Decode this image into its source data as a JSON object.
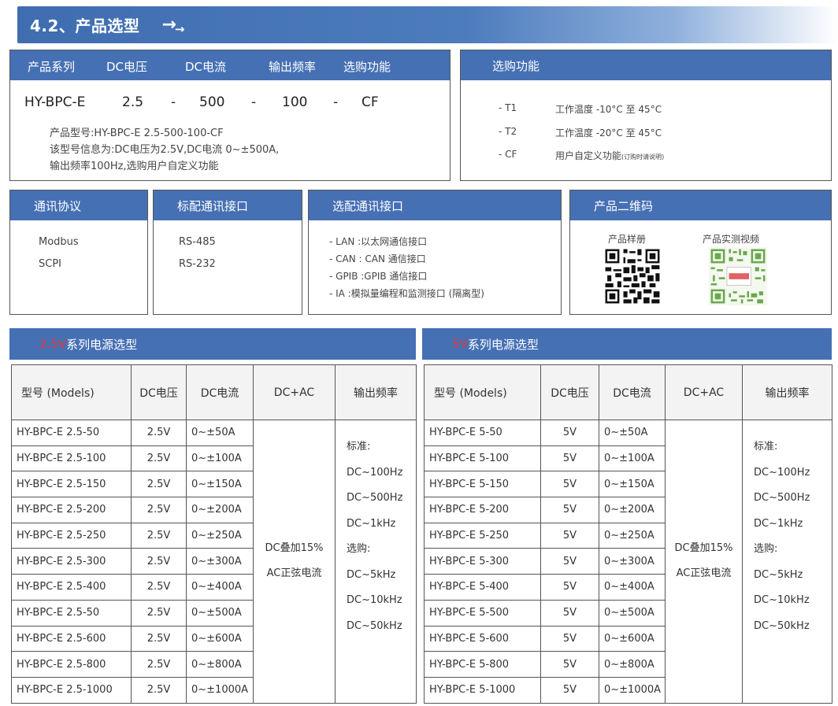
{
  "title": "4.2、产品选型",
  "title_arrows": "→",
  "model": {
    "headers": [
      "产品系列",
      "DC电压",
      "DC电流",
      "输出频率",
      "选购功能"
    ],
    "code": {
      "series": "HY-BPC-E",
      "voltage": "2.5",
      "dash": "-",
      "current": "500",
      "freq": "100",
      "option": "CF"
    },
    "desc": [
      "产品型号:HY-BPC-E 2.5-500-100-CF",
      "该型号信息为:DC电压为2.5V,DC电流 0~±500A,",
      "输出频率100Hz,选购用户自定义功能"
    ]
  },
  "options": {
    "header": "选购功能",
    "rows": [
      {
        "key": "- T1",
        "value": "工作温度 -10°C 至 45°C",
        "note": ""
      },
      {
        "key": "- T2",
        "value": "工作温度 -20°C 至 45°C",
        "note": ""
      },
      {
        "key": "- CF",
        "value": "用户自定义功能",
        "note": "(订购时请说明)"
      }
    ]
  },
  "protocol": {
    "header": "通讯协议",
    "items": [
      "Modbus",
      "SCPI"
    ]
  },
  "std_interface": {
    "header": "标配通讯接口",
    "items": [
      "RS-485",
      "RS-232"
    ]
  },
  "opt_interface": {
    "header": "选配通讯接口",
    "items": [
      "- LAN :以太网通信接口",
      "- CAN : CAN 通信接口",
      "- GPIB :GPIB 通信接口",
      "- IA   :模拟量编程和监测接口 (隔离型)"
    ]
  },
  "qr": {
    "header": "产品二维码",
    "labels": [
      "产品样册",
      "产品实测视频"
    ]
  },
  "colors": {
    "header_blue": "#4670b4",
    "series_red": "#e53935"
  },
  "series_25": {
    "title_red": "2.5V",
    "title_rest": "系列电源选型",
    "columns": [
      "型号 (Models)",
      "DC电压",
      "DC电流",
      "DC+AC",
      "输出频率"
    ],
    "rows": [
      [
        "HY-BPC-E 2.5-50",
        "2.5V",
        "0~±50A"
      ],
      [
        "HY-BPC-E 2.5-100",
        "2.5V",
        "0~±100A"
      ],
      [
        "HY-BPC-E 2.5-150",
        "2.5V",
        "0~±150A"
      ],
      [
        "HY-BPC-E 2.5-200",
        "2.5V",
        "0~±200A"
      ],
      [
        "HY-BPC-E 2.5-250",
        "2.5V",
        "0~±250A"
      ],
      [
        "HY-BPC-E 2.5-300",
        "2.5V",
        "0~±300A"
      ],
      [
        "HY-BPC-E 2.5-400",
        "2.5V",
        "0~±400A"
      ],
      [
        "HY-BPC-E 2.5-50",
        "2.5V",
        "0~±500A"
      ],
      [
        "HY-BPC-E 2.5-600",
        "2.5V",
        "0~±600A"
      ],
      [
        "HY-BPC-E 2.5-800",
        "2.5V",
        "0~±800A"
      ],
      [
        "HY-BPC-E 2.5-1000",
        "2.5V",
        "0~±1000A"
      ]
    ],
    "dcac": [
      "DC叠加15%",
      "AC正弦电流"
    ],
    "freq": [
      "标准:",
      "DC~100Hz",
      "DC~500Hz",
      "DC~1kHz",
      "选购:",
      "DC~5kHz",
      "DC~10kHz",
      "DC~50kHz"
    ]
  },
  "series_5": {
    "title_red": "5V",
    "title_rest": "系列电源选型",
    "columns": [
      "型号 (Models)",
      "DC电压",
      "DC电流",
      "DC+AC",
      "输出频率"
    ],
    "rows": [
      [
        "HY-BPC-E 5-50",
        "5V",
        "0~±50A"
      ],
      [
        "HY-BPC-E 5-100",
        "5V",
        "0~±100A"
      ],
      [
        "HY-BPC-E 5-150",
        "5V",
        "0~±150A"
      ],
      [
        "HY-BPC-E 5-200",
        "5V",
        "0~±200A"
      ],
      [
        "HY-BPC-E 5-250",
        "5V",
        "0~±250A"
      ],
      [
        "HY-BPC-E 5-300",
        "5V",
        "0~±300A"
      ],
      [
        "HY-BPC-E 5-400",
        "5V",
        "0~±400A"
      ],
      [
        "HY-BPC-E 5-500",
        "5V",
        "0~±500A"
      ],
      [
        "HY-BPC-E 5-600",
        "5V",
        "0~±600A"
      ],
      [
        "HY-BPC-E 5-800",
        "5V",
        "0~±800A"
      ],
      [
        "HY-BPC-E 5-1000",
        "5V",
        "0~±1000A"
      ]
    ],
    "dcac": [
      "DC叠加15%",
      "AC正弦电流"
    ],
    "freq": [
      "标准:",
      "DC~100Hz",
      "DC~500Hz",
      "DC~1kHz",
      "选购:",
      "DC~5kHz",
      "DC~10kHz",
      "DC~50kHz"
    ]
  }
}
